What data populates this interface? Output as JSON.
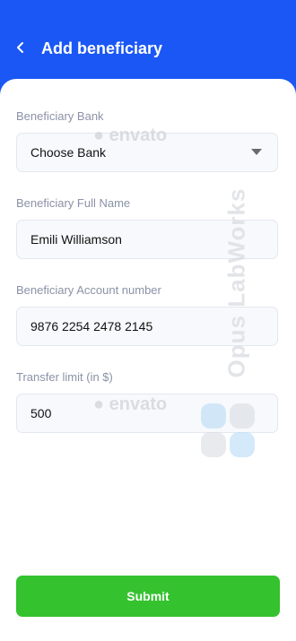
{
  "header": {
    "title": "Add beneficiary",
    "back_icon": "arrow-left-icon"
  },
  "form": {
    "bank": {
      "label": "Beneficiary Bank",
      "value": "Choose Bank",
      "icon": "chevron-down-icon"
    },
    "full_name": {
      "label": "Beneficiary Full Name",
      "value": "Emili Williamson"
    },
    "account_number": {
      "label": "Beneficiary Account number",
      "value": "9876 2254 2478 2145"
    },
    "transfer_limit": {
      "label": "Transfer limit (in $)",
      "value": "500"
    }
  },
  "submit_label": "Submit",
  "watermarks": {
    "envato": "envato",
    "vertical": "Opus LabWorks"
  },
  "colors": {
    "header_bg": "#1a57f5",
    "submit_bg": "#35c22f",
    "label": "#8a92a6",
    "field_bg": "#f7f9fc"
  }
}
